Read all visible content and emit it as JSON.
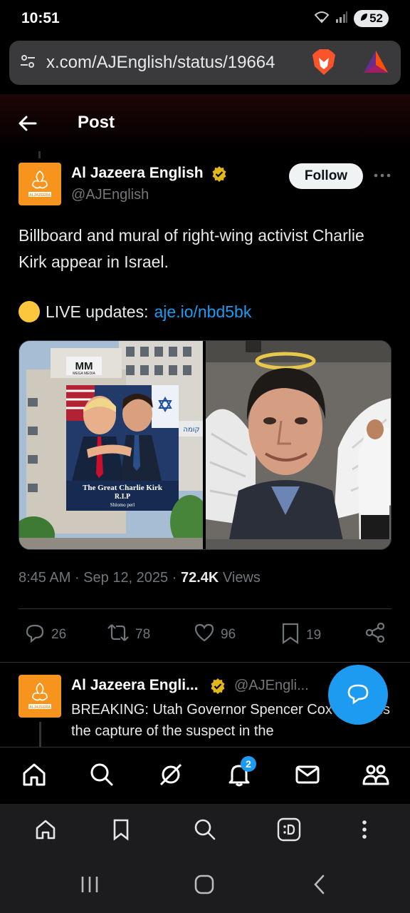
{
  "status_bar": {
    "time": "10:51",
    "battery": "52"
  },
  "browser": {
    "url": "x.com/AJEnglish/status/19664"
  },
  "header": {
    "title": "Post"
  },
  "post": {
    "author_name": "Al Jazeera English",
    "author_handle": "@AJEnglish",
    "follow_label": "Follow",
    "text": "Billboard and mural of right-wing activist Charlie Kirk  appear in Israel.",
    "live_label": "LIVE updates:",
    "live_link": "aje.io/nbd5bk",
    "media": {
      "billboard_brand": "MM",
      "billboard_brand_sub": "MEGA MEDIA",
      "billboard_caption_1": "The Great Charlie Kirk",
      "billboard_caption_2": "R.I.P",
      "billboard_caption_3": "Shlomo perl",
      "building_sign": "קומה"
    },
    "time": "8:45 AM",
    "date": "Sep 12, 2025",
    "views_count": "72.4K",
    "views_label": "Views",
    "stats": {
      "replies": "26",
      "reposts": "78",
      "likes": "96",
      "bookmarks": "19"
    }
  },
  "reply": {
    "author_name": "Al Jazeera Engli...",
    "author_handle": "@AJEngli...",
    "text": "BREAKING: Utah Governor Spencer Cox confirms the capture of the suspect in the"
  },
  "logo_text": "ALJAZEERA",
  "nav": {
    "notifications_badge": "2"
  },
  "colors": {
    "accent": "#1d9bf0",
    "brand": "#f7941d",
    "verified": "#e2b719"
  }
}
